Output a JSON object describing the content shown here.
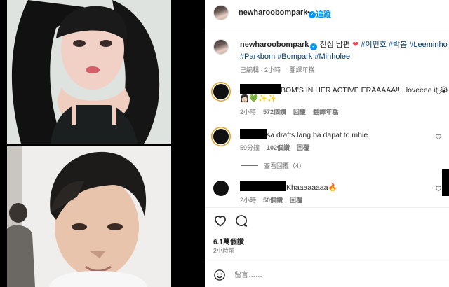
{
  "post": {
    "username": "newharoobompark",
    "follow_label": "追蹤",
    "more_label": "…"
  },
  "caption": {
    "username": "newharoobompark",
    "text_prefix": "진심 남편",
    "heart": "❤",
    "hashtags_line1": "#이민호 #박봄 #Leeminho",
    "hashtags_line2": "#Parkbom #Bompark #Minholee",
    "edited": "已編輯",
    "time": "2小時",
    "translate": "翻譯年糕"
  },
  "comments": [
    {
      "text": "BOM'S IN HER ACTIVE ERAAAAA!! I loveeee it 😭",
      "emojis": "👩🏻💚✨✨",
      "time": "2小時",
      "likes": "572個讚",
      "reply": "回覆",
      "translate": "翻譯年糕"
    },
    {
      "text": "sa drafts lang ba dapat to mhie",
      "time": "59分鐘",
      "likes": "102個讚",
      "reply": "回覆"
    },
    {
      "text": "Khaaaaaaaa🔥",
      "time": "2小時",
      "likes": "50個讚",
      "reply": "回覆"
    }
  ],
  "view_replies": "查看回覆（4）",
  "actions": {
    "likes": "6.1萬個讚",
    "time": "2小時前"
  },
  "comment_box": {
    "placeholder": "留言……"
  },
  "icons": {
    "verified": "verified-badge-icon",
    "like": "heart-outline-icon",
    "comment": "comment-bubble-icon",
    "emoji": "emoji-smile-icon"
  },
  "colors": {
    "accent": "#0095f6",
    "hashtag": "#00376b",
    "secondary_text": "#737373"
  }
}
